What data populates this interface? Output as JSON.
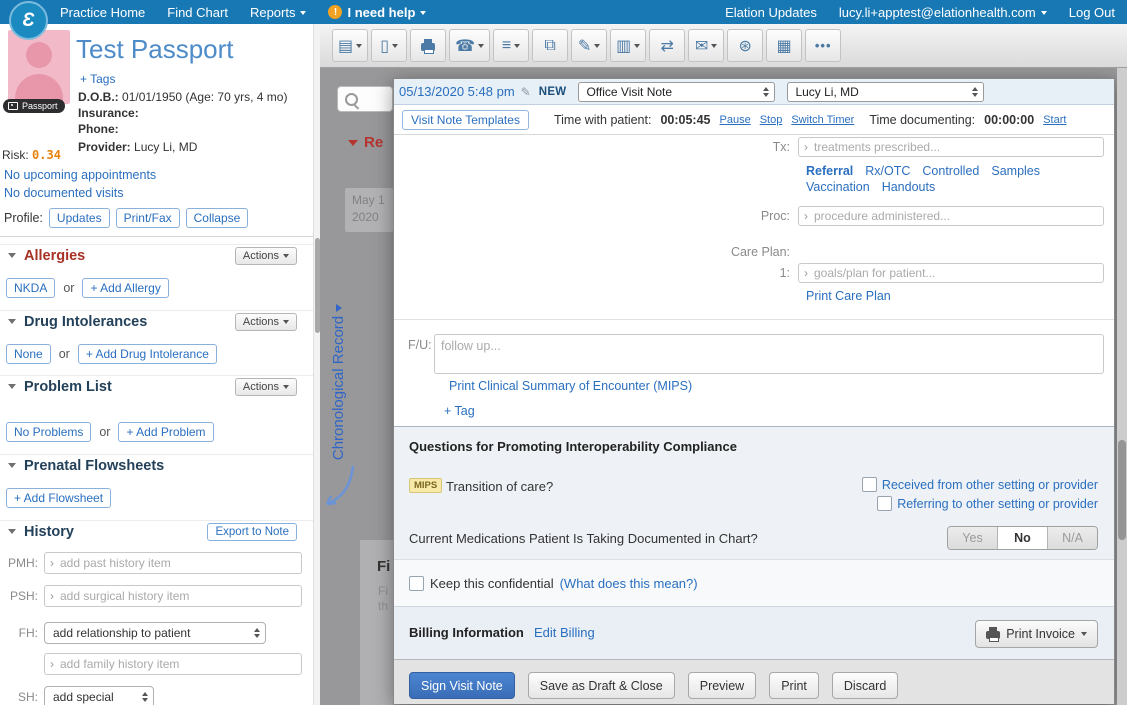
{
  "glyphs": {
    "logo": "Ɛ",
    "help_bang": "!",
    "pencil": "✎",
    "input_chevron": "›"
  },
  "topnav": {
    "practice_home": "Practice Home",
    "find_chart": "Find Chart",
    "reports": "Reports",
    "help_label": "I need help",
    "elation_updates": "Elation Updates",
    "account_email": "lucy.li+apptest@elationhealth.com",
    "log_out": "Log Out"
  },
  "patient": {
    "name": "Test Passport",
    "add_tags": "+ Tags",
    "passport_badge": "Passport",
    "dob_label": "D.O.B.:",
    "dob_value": "01/01/1950 (Age: 70 yrs, 4 mo)",
    "insurance_label": "Insurance:",
    "phone_label": "Phone:",
    "provider_label": "Provider:",
    "provider_value": "Lucy Li, MD",
    "risk_label": "Risk:",
    "risk_value": "0.34",
    "no_upcoming_appointments": "No upcoming appointments",
    "no_documented_visits": "No documented visits",
    "profile_label": "Profile:",
    "profile_updates": "Updates",
    "profile_printfax": "Print/Fax",
    "profile_collapse": "Collapse"
  },
  "sidebar": {
    "actions_label": "Actions",
    "or_label": "or",
    "allergies_title": "Allergies",
    "allergies_value": "NKDA",
    "allergies_add": "+ Add Allergy",
    "drug_title": "Drug Intolerances",
    "drug_value": "None",
    "drug_add": "+ Add Drug Intolerance",
    "problems_title": "Problem List",
    "problems_value": "No Problems",
    "problems_add": "+ Add Problem",
    "prenatal_title": "Prenatal Flowsheets",
    "prenatal_add": "+ Add Flowsheet",
    "history_title": "History",
    "history_export": "Export to Note",
    "pmh_label": "PMH:",
    "pmh_placeholder": "add past history item",
    "psh_label": "PSH:",
    "psh_placeholder": "add surgical history item",
    "fh_label": "FH:",
    "fh_select_value": "add relationship to patient",
    "fh_item_placeholder": "add family history item",
    "sh_label": "SH:",
    "sh_select_value": "add special"
  },
  "toolbar": {
    "icons": [
      {
        "name": "new-note",
        "glyph": "▤"
      },
      {
        "name": "new-document",
        "glyph": "▯"
      },
      {
        "name": "print-fax",
        "glyph": ""
      },
      {
        "name": "phone",
        "glyph": "☎"
      },
      {
        "name": "lists",
        "glyph": "≡"
      },
      {
        "name": "layers",
        "glyph": "⧉"
      },
      {
        "name": "edit",
        "glyph": "✎"
      },
      {
        "name": "labs",
        "glyph": "▥"
      },
      {
        "name": "transfer",
        "glyph": "⇄"
      },
      {
        "name": "mail",
        "glyph": "✉"
      },
      {
        "name": "settings",
        "glyph": "⊛"
      },
      {
        "name": "table",
        "glyph": "▦"
      }
    ],
    "more": "•••"
  },
  "backdrop": {
    "red_heading": "Re",
    "date_line1": "May 1",
    "date_line2": "2020",
    "chrono_label": "Chronological Record",
    "panel_heading": "Fi",
    "panel_line1": "Fi",
    "panel_line2": "th"
  },
  "note": {
    "datetime": "05/13/2020 5:48 pm",
    "new_badge": "NEW",
    "type_value": "Office Visit Note",
    "provider_value": "Lucy Li, MD",
    "templates_button": "Visit Note Templates",
    "time_with_patient_label": "Time with patient:",
    "time_with_patient_value": "00:05:45",
    "pause_link": "Pause",
    "stop_link": "Stop",
    "switch_timer_link": "Switch Timer",
    "time_documenting_label": "Time documenting:",
    "time_documenting_value": "00:00:00",
    "start_link": "Start",
    "tx_label": "Tx:",
    "tx_placeholder": "treatments prescribed...",
    "links": [
      "Referral",
      "Rx/OTC",
      "Controlled",
      "Samples",
      "Vaccination",
      "Handouts"
    ],
    "proc_label": "Proc:",
    "proc_placeholder": "procedure administered...",
    "care_plan_label": "Care Plan:",
    "care_plan_row": "1:",
    "care_plan_placeholder": "goals/plan for patient...",
    "print_care_plan_link": "Print Care Plan",
    "fu_label": "F/U:",
    "fu_placeholder": "follow up...",
    "print_summary_link": "Print Clinical Summary of Encounter (MIPS)",
    "add_tag_link": "+ Tag",
    "compliance_title": "Questions for Promoting Interoperability Compliance",
    "mips_badge": "MIPS",
    "transition_question": "Transition of care?",
    "checkbox_received": "Received from other setting or provider",
    "checkbox_referring": "Referring to other setting or provider",
    "meds_question": "Current Medications Patient Is Taking Documented in Chart?",
    "seg_yes": "Yes",
    "seg_no": "No",
    "seg_na": "N/A",
    "confidential_label": "Keep this confidential",
    "confidential_link": "(What does this mean?)",
    "billing_title": "Billing Information",
    "edit_billing_link": "Edit Billing",
    "print_invoice_button": "Print Invoice",
    "sign_button": "Sign Visit Note",
    "save_draft_button": "Save as Draft & Close",
    "preview_button": "Preview",
    "print_button": "Print",
    "discard_button": "Discard"
  }
}
